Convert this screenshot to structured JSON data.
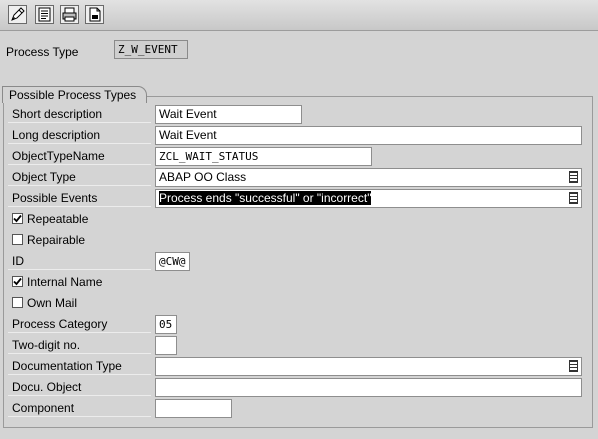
{
  "toolbar": {
    "buttons": [
      {
        "icon": "edit-pencil-icon"
      },
      {
        "icon": "display-list-icon"
      },
      {
        "icon": "print-icon"
      },
      {
        "icon": "document-save-icon"
      }
    ]
  },
  "process_type": {
    "label": "Process Type",
    "value": "Z_W_EVENT"
  },
  "group": {
    "title": "Possible Process Types",
    "short_description": {
      "label": "Short description",
      "value": "Wait Event"
    },
    "long_description": {
      "label": "Long description",
      "value": "Wait Event"
    },
    "object_type_name": {
      "label": "ObjectTypeName",
      "value": "ZCL_WAIT_STATUS"
    },
    "object_type": {
      "label": "Object Type",
      "value": "ABAP OO Class"
    },
    "possible_events": {
      "label": "Possible Events",
      "value": "Process ends \"successful\" or \"incorrect\""
    },
    "repeatable": {
      "label": "Repeatable",
      "checked": true
    },
    "repairable": {
      "label": "Repairable",
      "checked": false
    },
    "id": {
      "label": "ID",
      "value": "@CW@"
    },
    "internal_name": {
      "label": "Internal Name",
      "checked": true
    },
    "own_mail": {
      "label": "Own Mail",
      "checked": false
    },
    "process_category": {
      "label": "Process Category",
      "value": "05"
    },
    "two_digit_no": {
      "label": "Two-digit no.",
      "value": ""
    },
    "documentation_type": {
      "label": "Documentation Type",
      "value": ""
    },
    "docu_object": {
      "label": "Docu. Object",
      "value": ""
    },
    "component": {
      "label": "Component",
      "value": ""
    }
  }
}
